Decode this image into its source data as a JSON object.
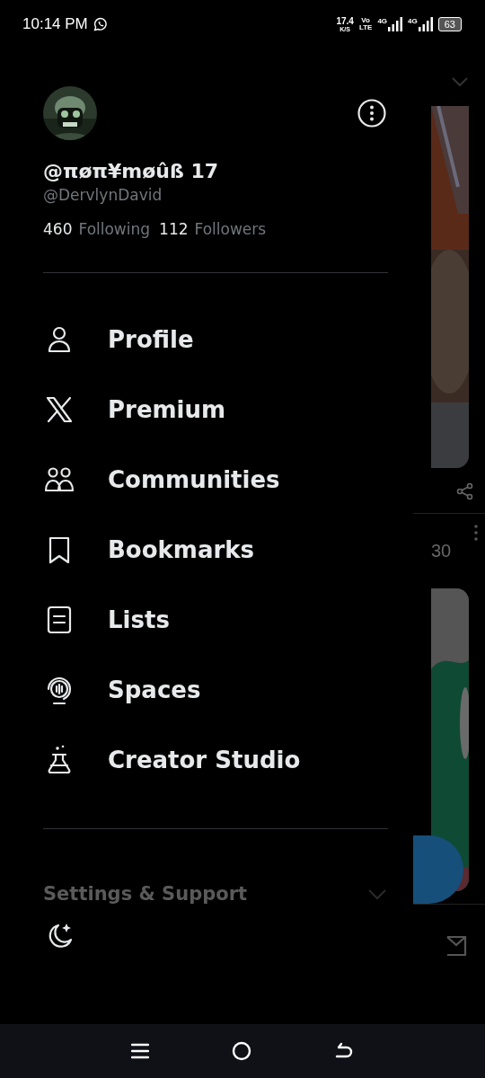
{
  "status_bar": {
    "time": "10:14 PM",
    "speed": "17.4",
    "speed_unit": "K/S",
    "volte_top": "Vo",
    "volte_bottom": "LTE",
    "network_1": "4G",
    "network_2": "4G",
    "battery": "63"
  },
  "profile": {
    "display_name": "@πøπ¥møûß 17",
    "handle": "@DervlynDavid",
    "following_count": "460",
    "following_label": "Following",
    "followers_count": "112",
    "followers_label": "Followers"
  },
  "menu": [
    {
      "label": "Profile"
    },
    {
      "label": "Premium"
    },
    {
      "label": "Communities"
    },
    {
      "label": "Bookmarks"
    },
    {
      "label": "Lists"
    },
    {
      "label": "Spaces"
    },
    {
      "label": "Creator Studio"
    }
  ],
  "settings_section": {
    "label": "Settings & Support",
    "expanded": false
  },
  "background_feed": {
    "count": "30"
  }
}
